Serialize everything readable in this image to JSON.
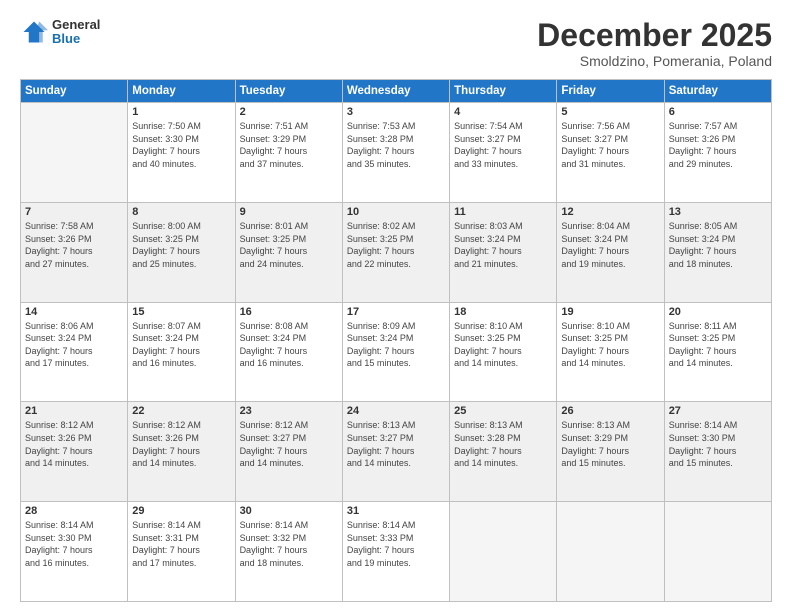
{
  "header": {
    "logo_general": "General",
    "logo_blue": "Blue",
    "title": "December 2025",
    "location": "Smoldzino, Pomerania, Poland"
  },
  "weekdays": [
    "Sunday",
    "Monday",
    "Tuesday",
    "Wednesday",
    "Thursday",
    "Friday",
    "Saturday"
  ],
  "weeks": [
    [
      {
        "day": "",
        "lines": [],
        "empty": true
      },
      {
        "day": "1",
        "lines": [
          "Sunrise: 7:50 AM",
          "Sunset: 3:30 PM",
          "Daylight: 7 hours",
          "and 40 minutes."
        ]
      },
      {
        "day": "2",
        "lines": [
          "Sunrise: 7:51 AM",
          "Sunset: 3:29 PM",
          "Daylight: 7 hours",
          "and 37 minutes."
        ]
      },
      {
        "day": "3",
        "lines": [
          "Sunrise: 7:53 AM",
          "Sunset: 3:28 PM",
          "Daylight: 7 hours",
          "and 35 minutes."
        ]
      },
      {
        "day": "4",
        "lines": [
          "Sunrise: 7:54 AM",
          "Sunset: 3:27 PM",
          "Daylight: 7 hours",
          "and 33 minutes."
        ]
      },
      {
        "day": "5",
        "lines": [
          "Sunrise: 7:56 AM",
          "Sunset: 3:27 PM",
          "Daylight: 7 hours",
          "and 31 minutes."
        ]
      },
      {
        "day": "6",
        "lines": [
          "Sunrise: 7:57 AM",
          "Sunset: 3:26 PM",
          "Daylight: 7 hours",
          "and 29 minutes."
        ]
      }
    ],
    [
      {
        "day": "7",
        "lines": [
          "Sunrise: 7:58 AM",
          "Sunset: 3:26 PM",
          "Daylight: 7 hours",
          "and 27 minutes."
        ]
      },
      {
        "day": "8",
        "lines": [
          "Sunrise: 8:00 AM",
          "Sunset: 3:25 PM",
          "Daylight: 7 hours",
          "and 25 minutes."
        ]
      },
      {
        "day": "9",
        "lines": [
          "Sunrise: 8:01 AM",
          "Sunset: 3:25 PM",
          "Daylight: 7 hours",
          "and 24 minutes."
        ]
      },
      {
        "day": "10",
        "lines": [
          "Sunrise: 8:02 AM",
          "Sunset: 3:25 PM",
          "Daylight: 7 hours",
          "and 22 minutes."
        ]
      },
      {
        "day": "11",
        "lines": [
          "Sunrise: 8:03 AM",
          "Sunset: 3:24 PM",
          "Daylight: 7 hours",
          "and 21 minutes."
        ]
      },
      {
        "day": "12",
        "lines": [
          "Sunrise: 8:04 AM",
          "Sunset: 3:24 PM",
          "Daylight: 7 hours",
          "and 19 minutes."
        ]
      },
      {
        "day": "13",
        "lines": [
          "Sunrise: 8:05 AM",
          "Sunset: 3:24 PM",
          "Daylight: 7 hours",
          "and 18 minutes."
        ]
      }
    ],
    [
      {
        "day": "14",
        "lines": [
          "Sunrise: 8:06 AM",
          "Sunset: 3:24 PM",
          "Daylight: 7 hours",
          "and 17 minutes."
        ]
      },
      {
        "day": "15",
        "lines": [
          "Sunrise: 8:07 AM",
          "Sunset: 3:24 PM",
          "Daylight: 7 hours",
          "and 16 minutes."
        ]
      },
      {
        "day": "16",
        "lines": [
          "Sunrise: 8:08 AM",
          "Sunset: 3:24 PM",
          "Daylight: 7 hours",
          "and 16 minutes."
        ]
      },
      {
        "day": "17",
        "lines": [
          "Sunrise: 8:09 AM",
          "Sunset: 3:24 PM",
          "Daylight: 7 hours",
          "and 15 minutes."
        ]
      },
      {
        "day": "18",
        "lines": [
          "Sunrise: 8:10 AM",
          "Sunset: 3:25 PM",
          "Daylight: 7 hours",
          "and 14 minutes."
        ]
      },
      {
        "day": "19",
        "lines": [
          "Sunrise: 8:10 AM",
          "Sunset: 3:25 PM",
          "Daylight: 7 hours",
          "and 14 minutes."
        ]
      },
      {
        "day": "20",
        "lines": [
          "Sunrise: 8:11 AM",
          "Sunset: 3:25 PM",
          "Daylight: 7 hours",
          "and 14 minutes."
        ]
      }
    ],
    [
      {
        "day": "21",
        "lines": [
          "Sunrise: 8:12 AM",
          "Sunset: 3:26 PM",
          "Daylight: 7 hours",
          "and 14 minutes."
        ]
      },
      {
        "day": "22",
        "lines": [
          "Sunrise: 8:12 AM",
          "Sunset: 3:26 PM",
          "Daylight: 7 hours",
          "and 14 minutes."
        ]
      },
      {
        "day": "23",
        "lines": [
          "Sunrise: 8:12 AM",
          "Sunset: 3:27 PM",
          "Daylight: 7 hours",
          "and 14 minutes."
        ]
      },
      {
        "day": "24",
        "lines": [
          "Sunrise: 8:13 AM",
          "Sunset: 3:27 PM",
          "Daylight: 7 hours",
          "and 14 minutes."
        ]
      },
      {
        "day": "25",
        "lines": [
          "Sunrise: 8:13 AM",
          "Sunset: 3:28 PM",
          "Daylight: 7 hours",
          "and 14 minutes."
        ]
      },
      {
        "day": "26",
        "lines": [
          "Sunrise: 8:13 AM",
          "Sunset: 3:29 PM",
          "Daylight: 7 hours",
          "and 15 minutes."
        ]
      },
      {
        "day": "27",
        "lines": [
          "Sunrise: 8:14 AM",
          "Sunset: 3:30 PM",
          "Daylight: 7 hours",
          "and 15 minutes."
        ]
      }
    ],
    [
      {
        "day": "28",
        "lines": [
          "Sunrise: 8:14 AM",
          "Sunset: 3:30 PM",
          "Daylight: 7 hours",
          "and 16 minutes."
        ]
      },
      {
        "day": "29",
        "lines": [
          "Sunrise: 8:14 AM",
          "Sunset: 3:31 PM",
          "Daylight: 7 hours",
          "and 17 minutes."
        ]
      },
      {
        "day": "30",
        "lines": [
          "Sunrise: 8:14 AM",
          "Sunset: 3:32 PM",
          "Daylight: 7 hours",
          "and 18 minutes."
        ]
      },
      {
        "day": "31",
        "lines": [
          "Sunrise: 8:14 AM",
          "Sunset: 3:33 PM",
          "Daylight: 7 hours",
          "and 19 minutes."
        ]
      },
      {
        "day": "",
        "lines": [],
        "empty": true
      },
      {
        "day": "",
        "lines": [],
        "empty": true
      },
      {
        "day": "",
        "lines": [],
        "empty": true
      }
    ]
  ]
}
